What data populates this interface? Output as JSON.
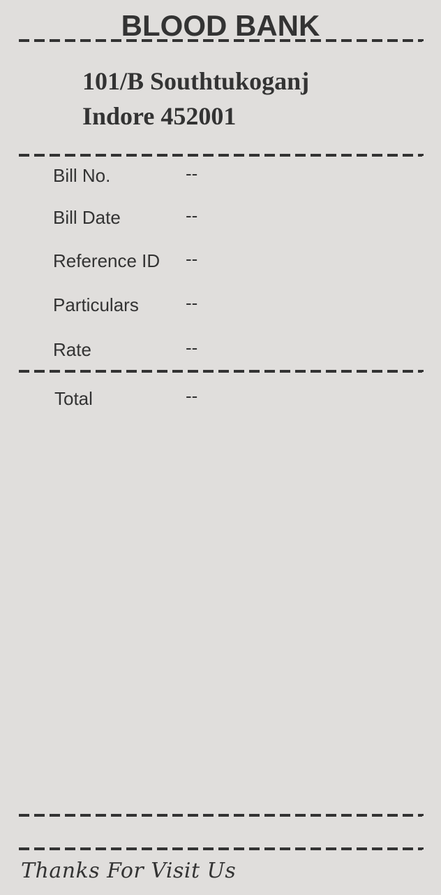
{
  "header": {
    "title": "BLOOD BANK",
    "address_line1": "101/B Southtukoganj",
    "address_line2": "Indore 452001"
  },
  "bill": {
    "rows": [
      {
        "label": "Bill No.",
        "value": "--"
      },
      {
        "label": "Bill Date",
        "value": "--"
      },
      {
        "label": "Reference ID",
        "value": "--"
      },
      {
        "label": "Particulars",
        "value": "--"
      },
      {
        "label": "Rate",
        "value": "--"
      }
    ],
    "total": {
      "label": "Total",
      "value": "--"
    }
  },
  "footer": {
    "text": "Thanks For Visit Us"
  }
}
